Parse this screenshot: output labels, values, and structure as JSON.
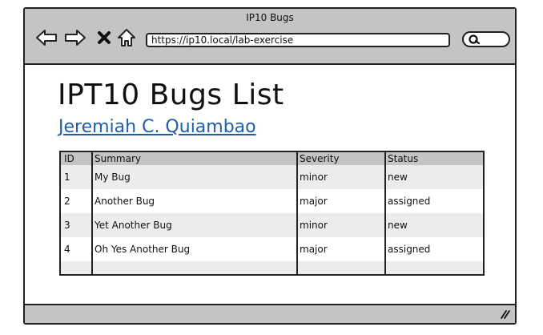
{
  "window": {
    "title": "IP10 Bugs"
  },
  "browser": {
    "address": "https://ip10.local/lab-exercise",
    "nav_icons": [
      "back-arrow-icon",
      "forward-arrow-icon",
      "close-x-icon",
      "home-icon"
    ],
    "search_icon": "search-icon"
  },
  "page": {
    "title": "IPT10 Bugs List",
    "author": "Jeremiah C. Quiambao"
  },
  "table": {
    "headers": [
      "ID",
      "Summary",
      "Severity",
      "Status"
    ],
    "rows": [
      [
        "1",
        "My Bug",
        "minor",
        "new"
      ],
      [
        "2",
        "Another Bug",
        "major",
        "assigned"
      ],
      [
        "3",
        "Yet Another Bug",
        "minor",
        "new"
      ],
      [
        "4",
        "Oh Yes Another Bug",
        "major",
        "assigned"
      ]
    ]
  },
  "colors": {
    "chrome": "#c4c4c4",
    "link": "#1f5ea8",
    "band": "#ececec"
  }
}
